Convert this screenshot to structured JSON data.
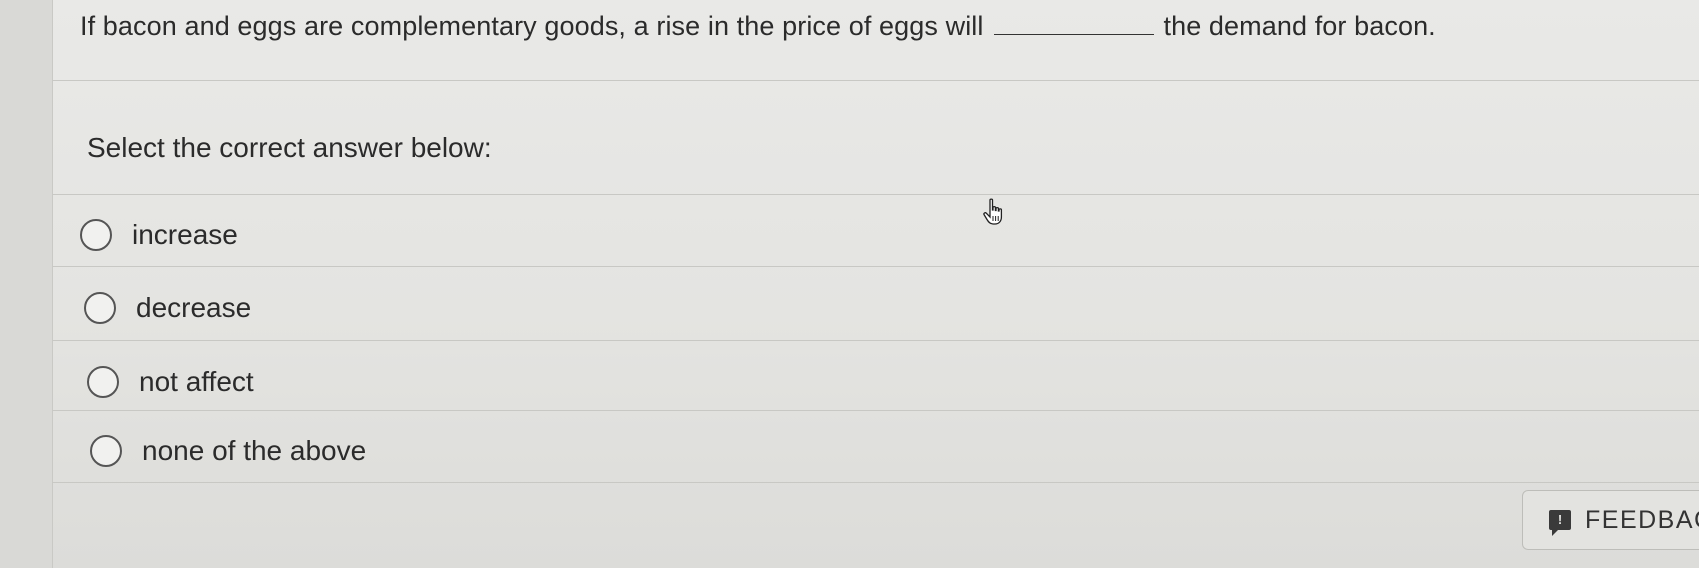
{
  "question": {
    "before_blank": "If bacon and eggs are complementary goods, a rise in the price of eggs will",
    "after_blank": "the demand for bacon."
  },
  "prompt": "Select the correct answer below:",
  "options": [
    {
      "label": "increase"
    },
    {
      "label": "decrease"
    },
    {
      "label": "not affect"
    },
    {
      "label": "none of the above"
    }
  ],
  "feedback": {
    "label": "FEEDBAC",
    "icon": "feedback-icon"
  },
  "cursor": {
    "icon": "hand-pointer-icon"
  }
}
